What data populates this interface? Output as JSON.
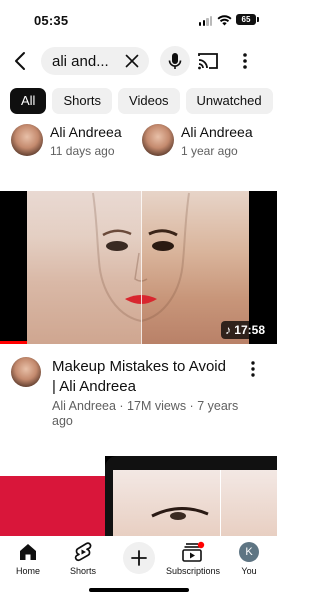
{
  "status_bar": {
    "time": "05:35",
    "battery": "65"
  },
  "search": {
    "query": "ali and..."
  },
  "chips": [
    "All",
    "Shorts",
    "Videos",
    "Unwatched"
  ],
  "channels": [
    {
      "name": "Ali Andreea",
      "when": "11 days ago"
    },
    {
      "name": "Ali Andreea",
      "when": "1 year ago"
    }
  ],
  "video": {
    "duration": "17:58",
    "title": "Makeup Mistakes to Avoid  | Ali Andreea",
    "subtitle": "Ali Andreea · 17M views · 7 years ago"
  },
  "bottom_nav": {
    "home": "Home",
    "shorts": "Shorts",
    "subscriptions": "Subscriptions",
    "you": "You",
    "avatar_letter": "K"
  },
  "colors": {
    "accent": "#ff0000",
    "chip_bg": "#f0f0f0",
    "active_chip": "#0f0f0f"
  }
}
